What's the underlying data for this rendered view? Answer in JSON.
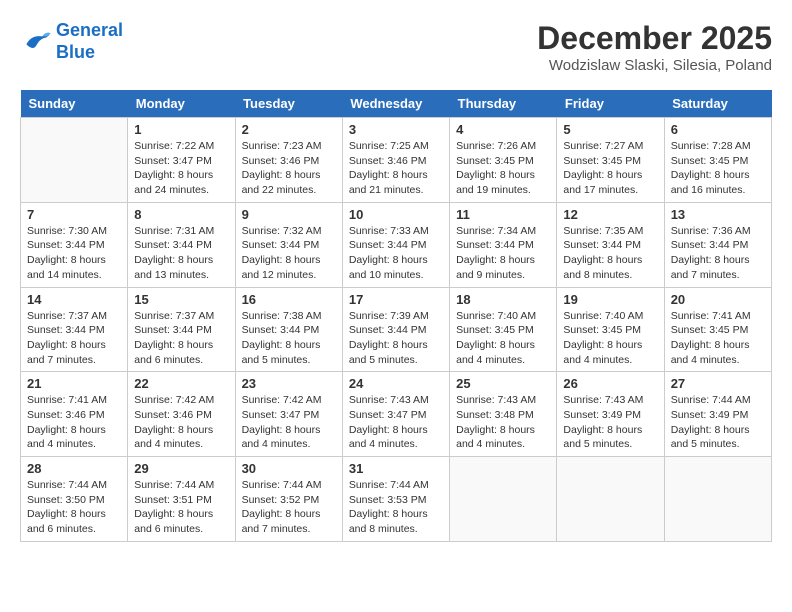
{
  "logo": {
    "line1": "General",
    "line2": "Blue"
  },
  "title": "December 2025",
  "subtitle": "Wodzislaw Slaski, Silesia, Poland",
  "weekdays": [
    "Sunday",
    "Monday",
    "Tuesday",
    "Wednesday",
    "Thursday",
    "Friday",
    "Saturday"
  ],
  "weeks": [
    [
      {
        "day": "",
        "info": ""
      },
      {
        "day": "1",
        "info": "Sunrise: 7:22 AM\nSunset: 3:47 PM\nDaylight: 8 hours\nand 24 minutes."
      },
      {
        "day": "2",
        "info": "Sunrise: 7:23 AM\nSunset: 3:46 PM\nDaylight: 8 hours\nand 22 minutes."
      },
      {
        "day": "3",
        "info": "Sunrise: 7:25 AM\nSunset: 3:46 PM\nDaylight: 8 hours\nand 21 minutes."
      },
      {
        "day": "4",
        "info": "Sunrise: 7:26 AM\nSunset: 3:45 PM\nDaylight: 8 hours\nand 19 minutes."
      },
      {
        "day": "5",
        "info": "Sunrise: 7:27 AM\nSunset: 3:45 PM\nDaylight: 8 hours\nand 17 minutes."
      },
      {
        "day": "6",
        "info": "Sunrise: 7:28 AM\nSunset: 3:45 PM\nDaylight: 8 hours\nand 16 minutes."
      }
    ],
    [
      {
        "day": "7",
        "info": "Sunrise: 7:30 AM\nSunset: 3:44 PM\nDaylight: 8 hours\nand 14 minutes."
      },
      {
        "day": "8",
        "info": "Sunrise: 7:31 AM\nSunset: 3:44 PM\nDaylight: 8 hours\nand 13 minutes."
      },
      {
        "day": "9",
        "info": "Sunrise: 7:32 AM\nSunset: 3:44 PM\nDaylight: 8 hours\nand 12 minutes."
      },
      {
        "day": "10",
        "info": "Sunrise: 7:33 AM\nSunset: 3:44 PM\nDaylight: 8 hours\nand 10 minutes."
      },
      {
        "day": "11",
        "info": "Sunrise: 7:34 AM\nSunset: 3:44 PM\nDaylight: 8 hours\nand 9 minutes."
      },
      {
        "day": "12",
        "info": "Sunrise: 7:35 AM\nSunset: 3:44 PM\nDaylight: 8 hours\nand 8 minutes."
      },
      {
        "day": "13",
        "info": "Sunrise: 7:36 AM\nSunset: 3:44 PM\nDaylight: 8 hours\nand 7 minutes."
      }
    ],
    [
      {
        "day": "14",
        "info": "Sunrise: 7:37 AM\nSunset: 3:44 PM\nDaylight: 8 hours\nand 7 minutes."
      },
      {
        "day": "15",
        "info": "Sunrise: 7:37 AM\nSunset: 3:44 PM\nDaylight: 8 hours\nand 6 minutes."
      },
      {
        "day": "16",
        "info": "Sunrise: 7:38 AM\nSunset: 3:44 PM\nDaylight: 8 hours\nand 5 minutes."
      },
      {
        "day": "17",
        "info": "Sunrise: 7:39 AM\nSunset: 3:44 PM\nDaylight: 8 hours\nand 5 minutes."
      },
      {
        "day": "18",
        "info": "Sunrise: 7:40 AM\nSunset: 3:45 PM\nDaylight: 8 hours\nand 4 minutes."
      },
      {
        "day": "19",
        "info": "Sunrise: 7:40 AM\nSunset: 3:45 PM\nDaylight: 8 hours\nand 4 minutes."
      },
      {
        "day": "20",
        "info": "Sunrise: 7:41 AM\nSunset: 3:45 PM\nDaylight: 8 hours\nand 4 minutes."
      }
    ],
    [
      {
        "day": "21",
        "info": "Sunrise: 7:41 AM\nSunset: 3:46 PM\nDaylight: 8 hours\nand 4 minutes."
      },
      {
        "day": "22",
        "info": "Sunrise: 7:42 AM\nSunset: 3:46 PM\nDaylight: 8 hours\nand 4 minutes."
      },
      {
        "day": "23",
        "info": "Sunrise: 7:42 AM\nSunset: 3:47 PM\nDaylight: 8 hours\nand 4 minutes."
      },
      {
        "day": "24",
        "info": "Sunrise: 7:43 AM\nSunset: 3:47 PM\nDaylight: 8 hours\nand 4 minutes."
      },
      {
        "day": "25",
        "info": "Sunrise: 7:43 AM\nSunset: 3:48 PM\nDaylight: 8 hours\nand 4 minutes."
      },
      {
        "day": "26",
        "info": "Sunrise: 7:43 AM\nSunset: 3:49 PM\nDaylight: 8 hours\nand 5 minutes."
      },
      {
        "day": "27",
        "info": "Sunrise: 7:44 AM\nSunset: 3:49 PM\nDaylight: 8 hours\nand 5 minutes."
      }
    ],
    [
      {
        "day": "28",
        "info": "Sunrise: 7:44 AM\nSunset: 3:50 PM\nDaylight: 8 hours\nand 6 minutes."
      },
      {
        "day": "29",
        "info": "Sunrise: 7:44 AM\nSunset: 3:51 PM\nDaylight: 8 hours\nand 6 minutes."
      },
      {
        "day": "30",
        "info": "Sunrise: 7:44 AM\nSunset: 3:52 PM\nDaylight: 8 hours\nand 7 minutes."
      },
      {
        "day": "31",
        "info": "Sunrise: 7:44 AM\nSunset: 3:53 PM\nDaylight: 8 hours\nand 8 minutes."
      },
      {
        "day": "",
        "info": ""
      },
      {
        "day": "",
        "info": ""
      },
      {
        "day": "",
        "info": ""
      }
    ]
  ]
}
